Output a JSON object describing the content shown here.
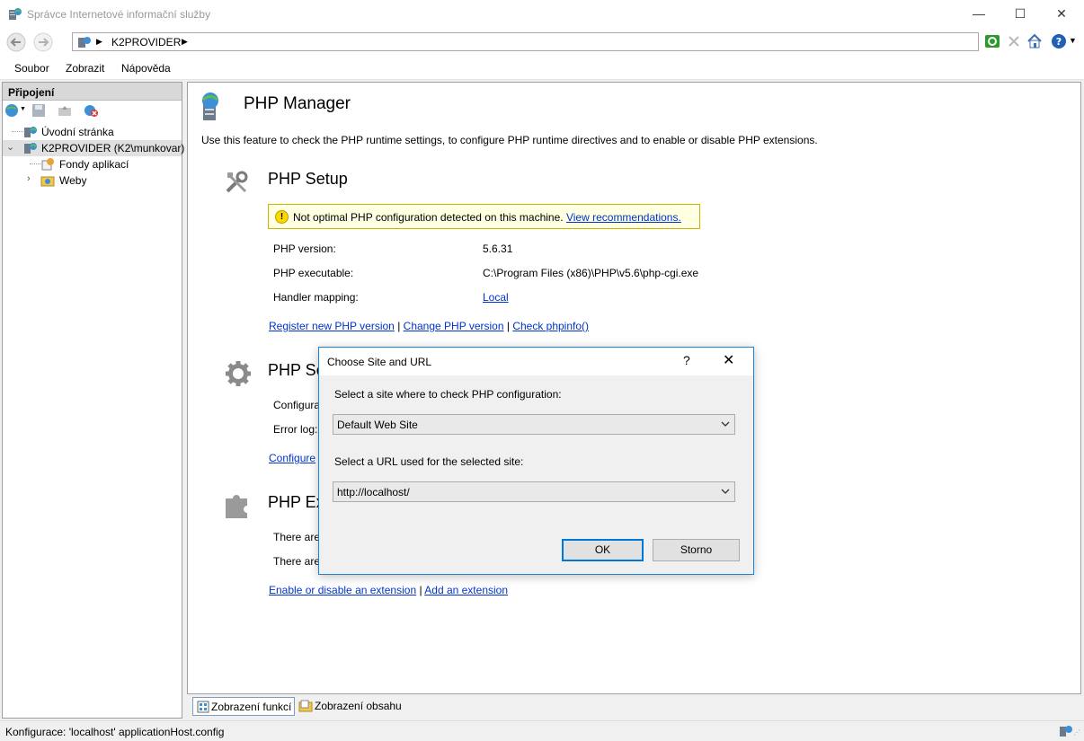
{
  "window": {
    "title": "Správce Internetové informační služby",
    "minimize": "—",
    "maximize": "☐",
    "close": "✕"
  },
  "address": {
    "crumbs": [
      "K2PROVIDER"
    ]
  },
  "menu": {
    "items": [
      "Soubor",
      "Zobrazit",
      "Nápověda"
    ]
  },
  "connections": {
    "header": "Připojení",
    "tree": [
      {
        "label": "Úvodní stránka"
      },
      {
        "label": "K2PROVIDER (K2\\munkovar)"
      },
      {
        "label": "Fondy aplikací"
      },
      {
        "label": "Weby"
      }
    ]
  },
  "main": {
    "title": "PHP Manager",
    "description": "Use this feature to check the PHP runtime settings, to configure PHP runtime directives and to enable or disable PHP extensions.",
    "setup": {
      "heading": "PHP Setup",
      "warning_text": "Not optimal PHP configuration detected on this machine.",
      "warning_link": "View recommendations.",
      "version_label": "PHP version:",
      "version_value": "5.6.31",
      "exe_label": "PHP executable:",
      "exe_value": "C:\\Program Files (x86)\\PHP\\v5.6\\php-cgi.exe",
      "handler_label": "Handler mapping:",
      "handler_value": "Local",
      "link_register": "Register new PHP version",
      "link_change": "Change PHP version",
      "link_phpinfo": "Check phpinfo()",
      "sep": "|"
    },
    "settings": {
      "heading": "PHP Se",
      "config_label": "Configura",
      "errorlog_label": "Error log:",
      "link_configure": "Configure"
    },
    "extensions": {
      "heading": "PHP Ex",
      "line1": "There are",
      "line2": "There are",
      "link_enable": "Enable or disable an extension",
      "link_add": "Add an extension",
      "sep": "|"
    }
  },
  "bottom_tabs": {
    "features": "Zobrazení funkcí",
    "content": "Zobrazení obsahu"
  },
  "status": {
    "text": "Konfigurace: 'localhost' applicationHost.config"
  },
  "dialog": {
    "title": "Choose Site and URL",
    "help": "?",
    "close": "✕",
    "site_label": "Select a site where to check PHP configuration:",
    "site_value": "Default Web Site",
    "url_label": "Select a URL used for the selected site:",
    "url_value": "http://localhost/",
    "ok": "OK",
    "cancel": "Storno"
  }
}
